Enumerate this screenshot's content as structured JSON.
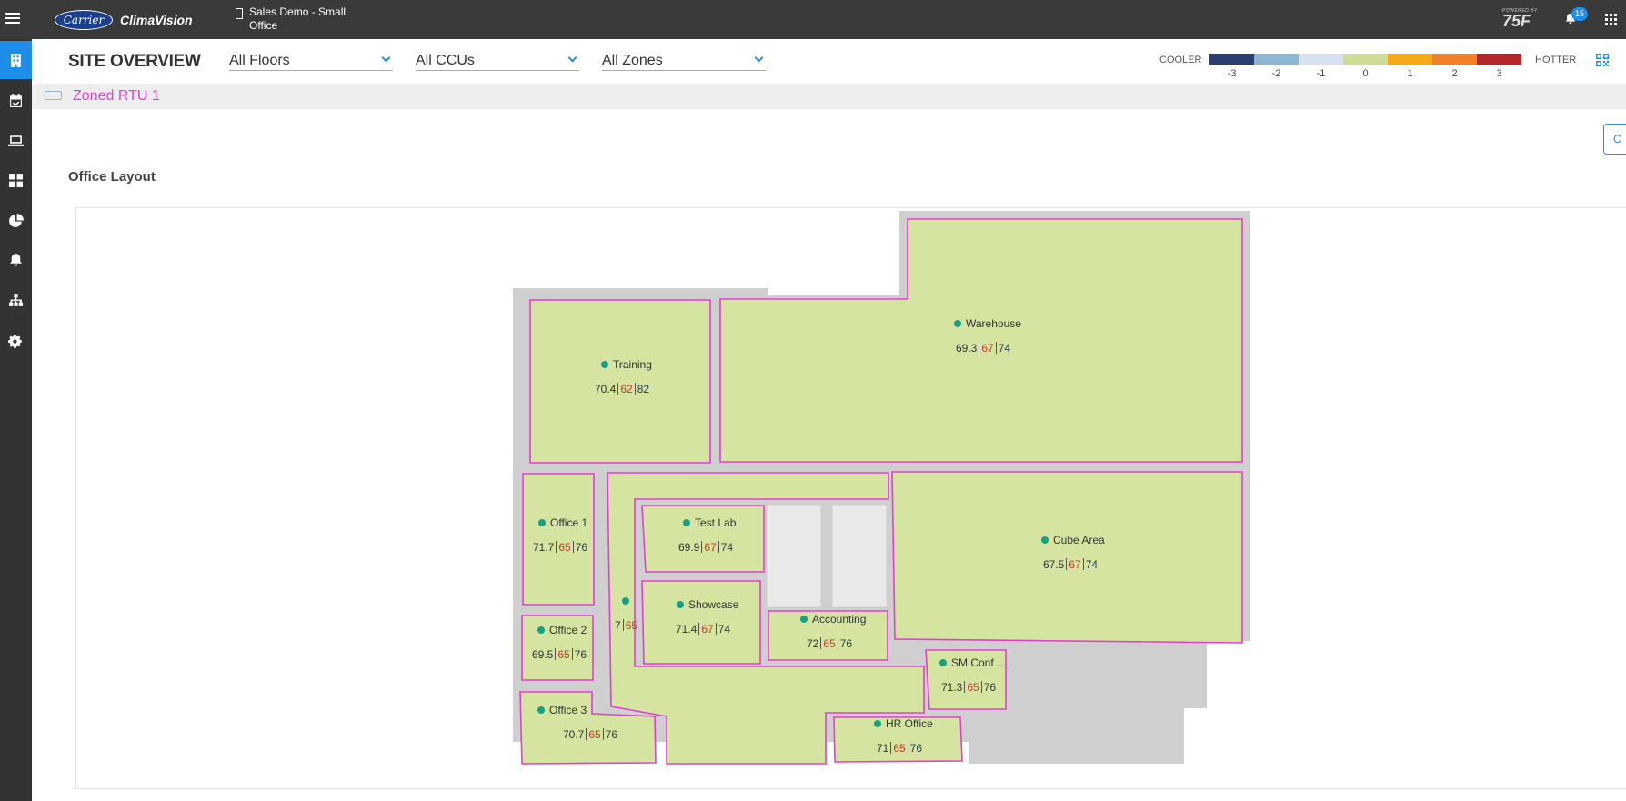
{
  "header": {
    "brand_logo": "Carrier",
    "product": "ClimaVision",
    "site_line1": "Sales Demo - Small",
    "site_line2": "Office",
    "powered_by": "POWERED BY",
    "powered_logo": "75F",
    "notification_count": "15"
  },
  "sidebar": {
    "items": [
      {
        "icon": "building-icon",
        "active": true
      },
      {
        "icon": "calendar-check-icon",
        "active": false
      },
      {
        "icon": "laptop-icon",
        "active": false
      },
      {
        "icon": "dashboard-grid-icon",
        "active": false
      },
      {
        "icon": "pie-chart-icon",
        "active": false
      },
      {
        "icon": "alarm-bell-icon",
        "active": false
      },
      {
        "icon": "sitemap-icon",
        "active": false
      },
      {
        "icon": "settings-gears-icon",
        "active": false
      }
    ]
  },
  "toolbar": {
    "title": "SITE OVERVIEW",
    "floors": "All Floors",
    "ccus": "All CCUs",
    "zones": "All Zones"
  },
  "legend": {
    "cooler": "COOLER",
    "hotter": "HOTTER",
    "colors": [
      "#2c3e6b",
      "#8fb6d1",
      "#d4e3ef",
      "#cddc97",
      "#f5a81c",
      "#f07f2c",
      "#b5282a"
    ],
    "ticks": [
      "-3",
      "-2",
      "-1",
      "0",
      "1",
      "2",
      "3"
    ]
  },
  "ccu": {
    "label": "Zoned RTU 1"
  },
  "corner_button": "C",
  "layout": {
    "title": "Office Layout"
  },
  "zones": [
    {
      "name": "Training",
      "current": "70.4",
      "heat": "62",
      "cool": "82"
    },
    {
      "name": "Warehouse",
      "current": "69.3",
      "heat": "67",
      "cool": "74"
    },
    {
      "name": "Office 1",
      "current": "71.7",
      "heat": "65",
      "cool": "76"
    },
    {
      "name": "Test Lab",
      "current": "69.9",
      "heat": "67",
      "cool": "74"
    },
    {
      "name": "Cube Area",
      "current": "67.5",
      "heat": "67",
      "cool": "74"
    },
    {
      "name": "Showcase",
      "current": "71.4",
      "heat": "67",
      "cool": "74"
    },
    {
      "name": "Accounting",
      "current": "72",
      "heat": "65",
      "cool": "76"
    },
    {
      "name": "Office 2",
      "current": "69.5",
      "heat": "65",
      "cool": "76"
    },
    {
      "name": "SM Conf ...",
      "current": "71.3",
      "heat": "65",
      "cool": "76"
    },
    {
      "name": "Office 3",
      "current": "70.7",
      "heat": "65",
      "cool": "76"
    },
    {
      "name": "HR Office",
      "current": "71",
      "heat": "65",
      "cool": "76"
    },
    {
      "name": "",
      "current": "7",
      "heat": "65",
      "cool": ""
    }
  ]
}
